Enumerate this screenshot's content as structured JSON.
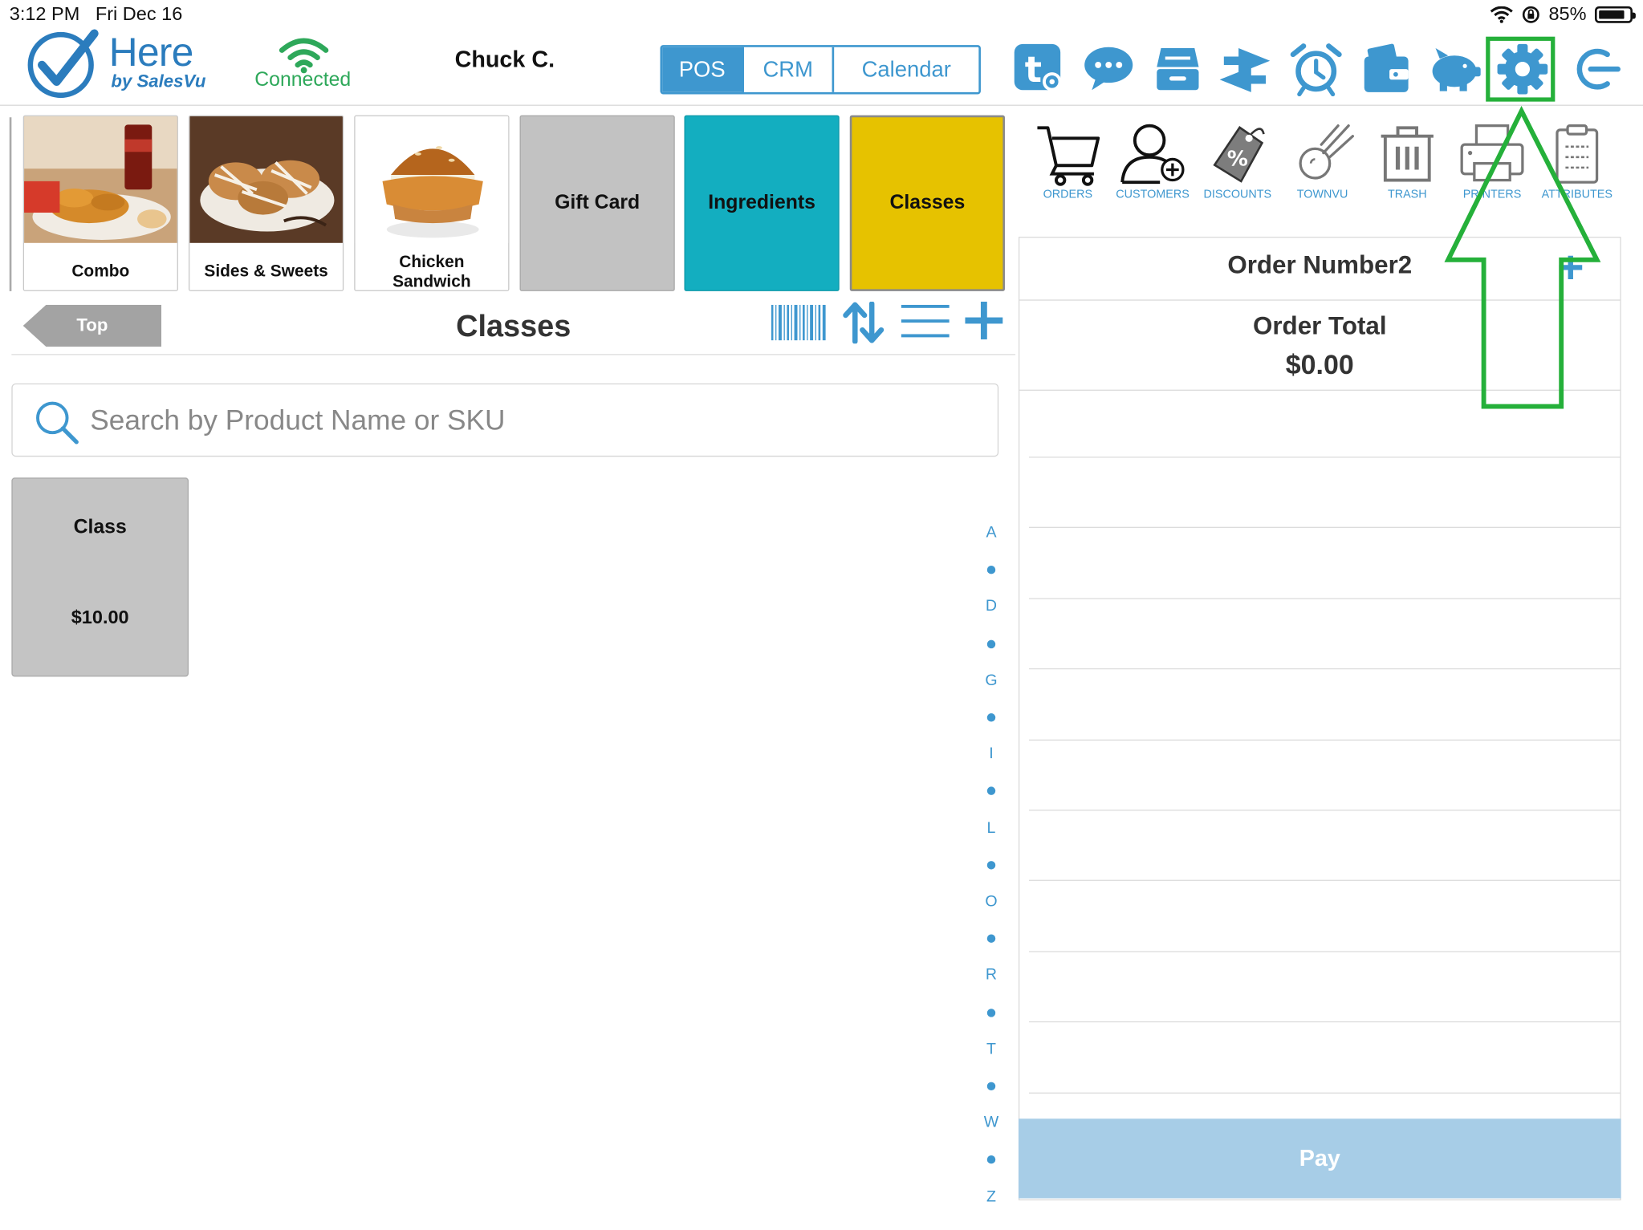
{
  "status_bar": {
    "time": "3:12 PM",
    "date": "Fri Dec 16",
    "battery": "85%",
    "battery_level": 0.85
  },
  "header": {
    "logo_word": "Here",
    "logo_sub": "by SalesVu",
    "connection": "Connected",
    "user": "Chuck C.",
    "tabs": [
      {
        "label": "POS",
        "active": true
      },
      {
        "label": "CRM",
        "active": false
      },
      {
        "label": "Calendar",
        "active": false
      }
    ],
    "icons": [
      "tips-settings-icon",
      "chat-icon",
      "cash-drawer-icon",
      "transfer-icon",
      "alarm-clock-icon",
      "wallet-icon",
      "piggy-bank-icon",
      "gear-icon",
      "logout-icon"
    ]
  },
  "categories": [
    {
      "label": "Combo",
      "type": "image"
    },
    {
      "label": "Sides & Sweets",
      "type": "image"
    },
    {
      "label": "Chicken Sandwich",
      "type": "image"
    },
    {
      "label": "Gift Card",
      "type": "solid",
      "color": "#c2c2c2"
    },
    {
      "label": "Ingredients",
      "type": "solid",
      "color": "#13aec0"
    },
    {
      "label": "Classes",
      "type": "solid",
      "color": "#e6c200"
    }
  ],
  "toolbar": {
    "back_label": "Top",
    "title": "Classes"
  },
  "search": {
    "placeholder": "Search by Product Name or SKU"
  },
  "products": [
    {
      "name": "Class",
      "price": "$10.00"
    }
  ],
  "alphabet": [
    "A",
    "D",
    "G",
    "I",
    "L",
    "O",
    "R",
    "T",
    "W",
    "Z"
  ],
  "actions": [
    {
      "label": "ORDERS"
    },
    {
      "label": "CUSTOMERS"
    },
    {
      "label": "DISCOUNTS"
    },
    {
      "label": "TOWNVU"
    },
    {
      "label": "TRASH"
    },
    {
      "label": "PRINTERS"
    },
    {
      "label": "ATTRIBUTES"
    }
  ],
  "order": {
    "title": "Order Number2",
    "total_label": "Order Total",
    "total_value": "$0.00",
    "pay_label": "Pay"
  },
  "colors": {
    "accent": "#3e97cf",
    "highlight": "#25b03a",
    "connected": "#2ea85a"
  }
}
